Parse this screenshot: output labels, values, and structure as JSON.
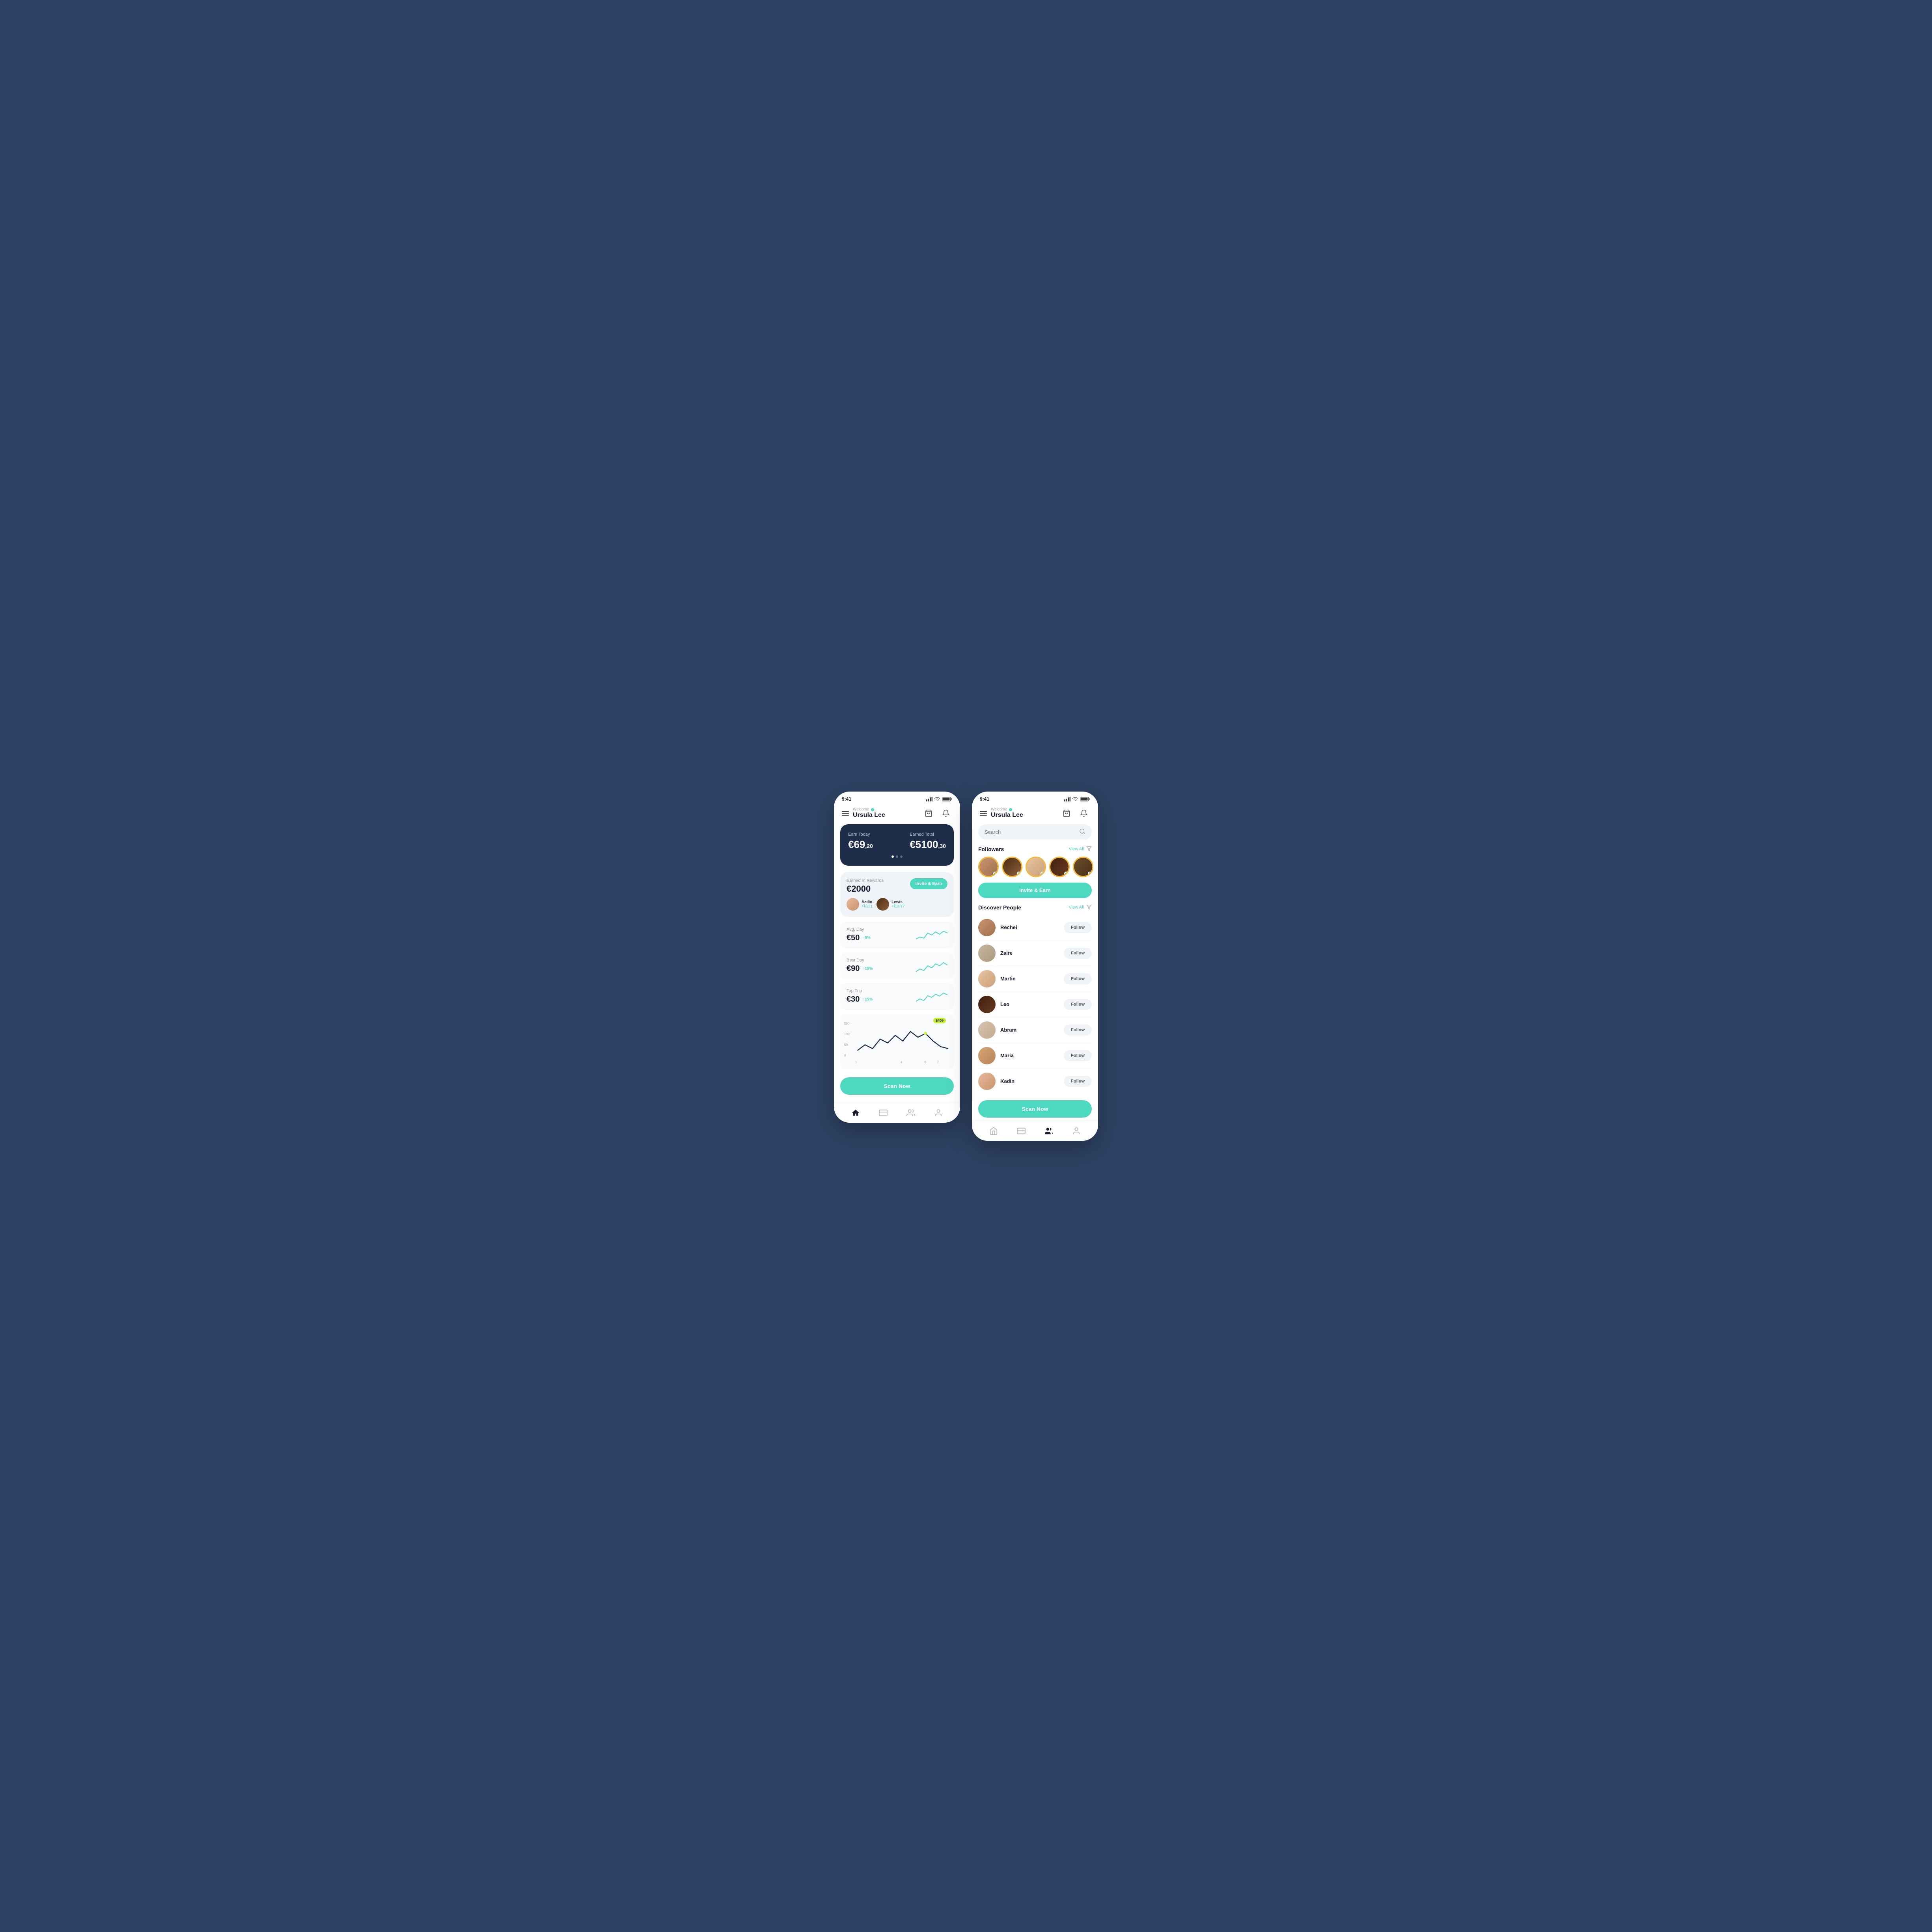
{
  "app": {
    "status_time": "9:41",
    "welcome_label": "Welcome",
    "user_name": "Ursula Lee"
  },
  "phone1": {
    "earn_today_label": "Earn Today",
    "earn_today_amount": "€69",
    "earn_today_cents": ",20",
    "earned_total_label": "Earned Total",
    "earned_total_amount": "€5100",
    "earned_total_cents": ",30",
    "rewards_label": "Earned In Rewards",
    "rewards_amount": "€2000",
    "invite_btn": "Invite & Earn",
    "friends": [
      {
        "name": "Azdin",
        "earn": "+€121"
      },
      {
        "name": "Lewis",
        "earn": "+€1077"
      }
    ],
    "stats": [
      {
        "label": "Avg. Day",
        "amount": "€50",
        "change": "5%",
        "id": "avg"
      },
      {
        "label": "Best Day",
        "amount": "€90",
        "change": "15%",
        "id": "best"
      },
      {
        "label": "Top Trip",
        "amount": "€30",
        "change": "15%",
        "id": "trip"
      }
    ],
    "chart_tooltip": "$409",
    "chart_y_labels": [
      "500",
      "100",
      "50",
      "0"
    ],
    "chart_x_labels": [
      "1",
      "",
      "",
      "",
      "4",
      "",
      "6",
      "7"
    ],
    "scan_btn": "Scan Now",
    "nav": [
      "home",
      "wallet",
      "people",
      "profile"
    ]
  },
  "phone2": {
    "search_placeholder": "Search",
    "followers_label": "Followers",
    "view_all": "View All",
    "invite_earn_btn": "Invite & Earn",
    "discover_label": "Discover People",
    "people": [
      {
        "name": "Rechei",
        "id": "rechei"
      },
      {
        "name": "Zaire",
        "id": "zaire"
      },
      {
        "name": "Martin",
        "id": "martin"
      },
      {
        "name": "Leo",
        "id": "leo"
      },
      {
        "name": "Abram",
        "id": "abram"
      },
      {
        "name": "Maria",
        "id": "maria"
      },
      {
        "name": "Kadin",
        "id": "kadin"
      }
    ],
    "follow_btn": "Follow",
    "scan_btn": "Scan Now",
    "nav": [
      "home",
      "wallet",
      "people",
      "profile"
    ]
  }
}
